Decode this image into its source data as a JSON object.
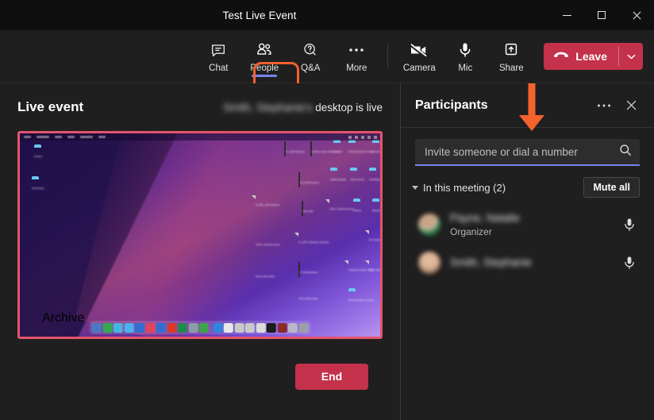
{
  "window": {
    "title": "Test Live Event",
    "controls": {
      "minimize": "minimize-icon",
      "maximize": "maximize-icon",
      "close": "close-icon"
    }
  },
  "toolbar": {
    "items": [
      {
        "label": "Chat",
        "icon": "chat-icon",
        "active": false
      },
      {
        "label": "People",
        "icon": "people-icon",
        "active": true
      },
      {
        "label": "Q&A",
        "icon": "qa-icon",
        "active": false
      },
      {
        "label": "More",
        "icon": "ellipsis-icon",
        "active": false
      },
      {
        "label": "Camera",
        "icon": "camera-off-icon",
        "active": false
      },
      {
        "label": "Mic",
        "icon": "mic-icon",
        "active": false
      },
      {
        "label": "Share",
        "icon": "share-tray-icon",
        "active": false
      }
    ],
    "leave_label": "Leave",
    "leave_caret": "chevron-down-icon"
  },
  "stage": {
    "title": "Live event",
    "presenter_name": "Smith, Stephanie's",
    "status_suffix": "desktop is live",
    "end_label": "End",
    "share_border_color": "#e3546b",
    "desktop": {
      "os": "macOS",
      "menubar_items": [
        "apple-menu-icon",
        "app-name",
        "File",
        "Edit",
        "View",
        "Window",
        "Help"
      ],
      "desktop_icons": [
        {
          "type": "folder",
          "caption": "Archive"
        },
        {
          "type": "folder",
          "caption": "Dual Factor"
        },
        {
          "type": "dark",
          "caption": "FY_2024 Meeting"
        },
        {
          "type": "dark",
          "caption": "Incident Intake DRAFT v2"
        },
        {
          "type": "dark",
          "caption": "SS_Staff Reviews"
        },
        {
          "type": "dark",
          "caption": "HR_Audit"
        },
        {
          "type": "doc",
          "caption": "Q_SEC_2024 Baseline"
        },
        {
          "type": "dark",
          "caption": "CL_RPT Hardware Checkout"
        },
        {
          "type": "dark",
          "caption": "IT Staffing Board"
        },
        {
          "type": "doc",
          "caption": "Cyber_Training Invoice"
        },
        {
          "type": "shot",
          "caption": "Screen Recording"
        },
        {
          "type": "folder",
          "caption": "Invoices"
        },
        {
          "type": "folder",
          "caption": "EOM Schedule Timeline"
        },
        {
          "type": "folder",
          "caption": "Enrollment"
        },
        {
          "type": "folder",
          "caption": "Alignment Files"
        },
        {
          "type": "folder",
          "caption": "Digital Signage"
        },
        {
          "type": "folder",
          "caption": "Cybersecurity"
        },
        {
          "type": "folder",
          "caption": "Q3 Budget Analysis"
        },
        {
          "type": "folder",
          "caption": "IT Workloads Consolidated"
        },
        {
          "type": "folder",
          "caption": "Classes"
        },
        {
          "type": "folder",
          "caption": "Resources"
        },
        {
          "type": "folder",
          "caption": "Vendor Review"
        },
        {
          "type": "doc",
          "caption": "PCI Vendor images"
        },
        {
          "type": "doc",
          "caption": "User Changes Worksheet"
        },
        {
          "type": "doc",
          "caption": "Hardware Intake FORM"
        },
        {
          "type": "doc",
          "caption": "TI_IT_2024 Budget Q1 Review"
        }
      ],
      "dock_app_count": 20,
      "dock_colors": [
        "#4a79c4",
        "#34a853",
        "#44b4e0",
        "#4ab0f0",
        "#2f6fd0",
        "#e0455e",
        "#2f6fd0",
        "#d9392b",
        "#1f8a4c",
        "#8f9aa8",
        "#3fa34d",
        "#2e86de",
        "#e8e8e8",
        "#c9c9c9",
        "#c9c9c9",
        "#dcdcdc",
        "#1c1c1c",
        "#8a2b2b",
        "#b8b8c6",
        "#9aa0a6"
      ]
    }
  },
  "panel": {
    "title": "Participants",
    "more_icon": "ellipsis-icon",
    "close_icon": "close-icon",
    "search": {
      "placeholder": "Invite someone or dial a number",
      "value": "",
      "icon": "search-icon"
    },
    "section": {
      "caret": "chevron-down-icon",
      "label": "In this meeting (2)",
      "mute_all_label": "Mute all"
    },
    "participants": [
      {
        "name": "Payne, Natalie",
        "role": "Organizer",
        "mic_icon": "mic-icon",
        "avatar": "photo-avatar"
      },
      {
        "name": "Smith, Stephanie",
        "role": "",
        "mic_icon": "mic-icon",
        "avatar": "photo-avatar"
      }
    ]
  },
  "annotations": {
    "highlight_target": "People",
    "highlight_color": "#f4622d",
    "arrow_color": "#f4622d",
    "arrow_direction": "down"
  }
}
